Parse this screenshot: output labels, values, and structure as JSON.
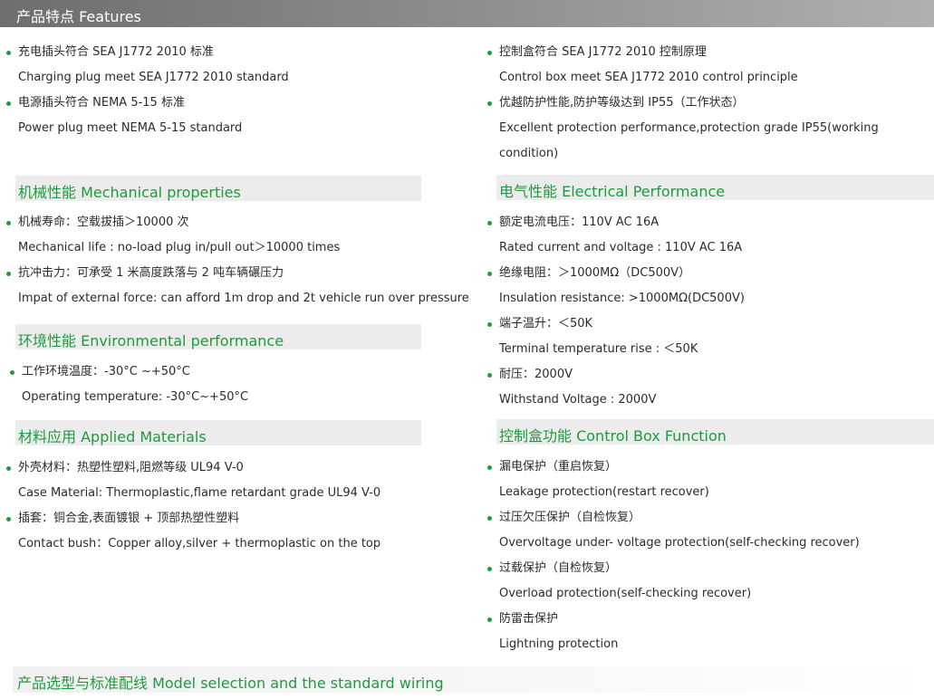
{
  "header": {
    "title": "产品特点 Features"
  },
  "features": {
    "left": [
      {
        "zh": "充电插头符合 SEA J1772 2010 标准",
        "en": "Charging plug meet SEA J1772 2010 standard"
      },
      {
        "zh": "电源插头符合 NEMA 5-15 标准",
        "en": "Power plug meet NEMA 5-15 standard"
      }
    ],
    "right": [
      {
        "zh": "控制盒符合 SEA J1772 2010 控制原理",
        "en": "Control box meet SEA J1772 2010 control principle"
      },
      {
        "zh": "优越防护性能,防护等级达到 IP55（工作状态）",
        "en": "Excellent protection performance,protection grade IP55(working condition)"
      }
    ]
  },
  "mechanical": {
    "title": "机械性能 Mechanical properties",
    "items": [
      {
        "zh": "机械寿命：空载拔插＞10000 次",
        "en": "Mechanical life : no-load plug in/pull out＞10000 times"
      },
      {
        "zh": "抗冲击力：可承受 1 米高度跌落与 2 吨车辆碾压力",
        "en": "Impat of external force: can afford 1m drop and 2t vehicle run over pressure"
      }
    ]
  },
  "environmental": {
    "title": "环境性能 Environmental performance",
    "items": [
      {
        "zh": "工作环境温度：-30°C ~+50°C",
        "en": "Operating temperature: -30°C~+50°C"
      }
    ]
  },
  "materials": {
    "title": "材料应用 Applied Materials",
    "items": [
      {
        "zh": "外壳材料：热塑性塑料,阻燃等级 UL94 V-0",
        "en": "Case Material: Thermoplastic,flame retardant grade UL94 V-0"
      },
      {
        "zh": "插套：铜合金,表面镀银 + 顶部热塑性塑料",
        "en": "Contact bush：Copper alloy,silver + thermoplastic on the top"
      }
    ]
  },
  "electrical": {
    "title": "电气性能 Electrical Performance",
    "items": [
      {
        "zh": "额定电流电压：110V AC 16A",
        "en": "Rated current and voltage : 110V AC 16A"
      },
      {
        "zh": "绝缘电阻：＞1000MΩ（DC500V）",
        "en": "Insulation resistance: >1000MΩ(DC500V)"
      },
      {
        "zh": "端子温升：＜50K",
        "en": "Terminal temperature rise : ＜50K"
      },
      {
        "zh": "耐压：2000V",
        "en": "Withstand Voltage : 2000V"
      }
    ]
  },
  "control_box": {
    "title": "控制盒功能 Control Box Function",
    "items": [
      {
        "zh": "漏电保护（重启恢复）",
        "en": "Leakage protection(restart recover)"
      },
      {
        "zh": "过压欠压保护（自检恢复）",
        "en": "Overvoltage under- voltage protection(self-checking recover)"
      },
      {
        "zh": "过载保护（自检恢复）",
        "en": "Overload protection(self-checking recover)"
      },
      {
        "zh": "防雷击保护",
        "en": "Lightning protection"
      }
    ]
  },
  "footer": {
    "title": "产品选型与标准配线 Model selection and the standard wiring"
  },
  "colors": {
    "accent": "#1e9b3f",
    "title_bar": "#7a7a7a",
    "section_bg": "#ececec"
  }
}
